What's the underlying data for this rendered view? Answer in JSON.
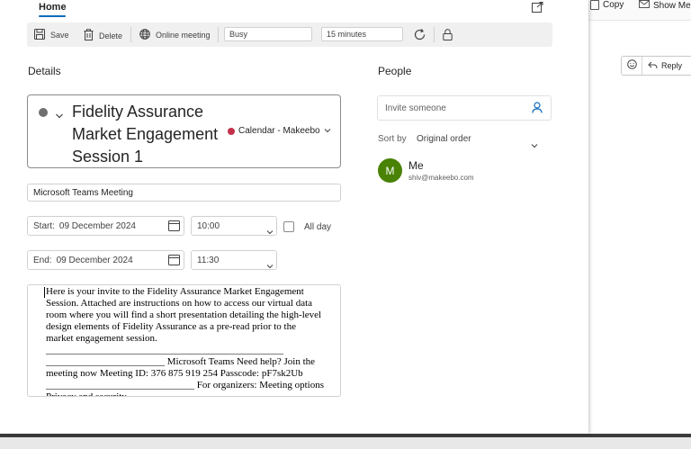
{
  "background": {
    "toolbar": {
      "copy_label": "Copy",
      "show_label": "Show Me"
    },
    "reply_label": "Reply"
  },
  "header": {
    "tab_home": "Home"
  },
  "toolbar": {
    "save_label": "Save",
    "delete_label": "Delete",
    "online_meeting_label": "Online meeting",
    "show_as_value": "Busy",
    "reminder_value": "15 minutes"
  },
  "details": {
    "heading": "Details",
    "title_lines": [
      "Fidelity Assurance",
      "Market Engagement",
      "Session 1"
    ],
    "calendar_label": "Calendar - Makeebo",
    "location_value": "Microsoft Teams Meeting",
    "start_label": "Start:",
    "start_date": "09 December 2024",
    "start_time": "10:00",
    "all_day_label": "All day",
    "end_label": "End:",
    "end_date": "09 December 2024",
    "end_time": "11:30",
    "body_text": "Here is your invite to the Fidelity Assurance Market Engagement Session. Attached are instructions on how to access our virtual data room where you will find a short presentation detailing the high-level design elements of Fidelity Assurance as a pre-read prior to the market engagement session.\n________________________________________________\n________________________ Microsoft Teams Need help? Join the meeting now Meeting ID: 376 875 919 254 Passcode: pF7sk2Ub\n______________________________ For organizers: Meeting options Privacy and security"
  },
  "people": {
    "heading": "People",
    "invite_placeholder": "Invite someone",
    "sort_label": "Sort by",
    "sort_value": "Original order",
    "attendee_initial": "M",
    "attendee_name": "Me",
    "attendee_email": "shiv@makeebo.com"
  },
  "colors": {
    "accent": "#0f6cbd",
    "avatar": "#498205",
    "calendar_dot": "#c4314b"
  }
}
